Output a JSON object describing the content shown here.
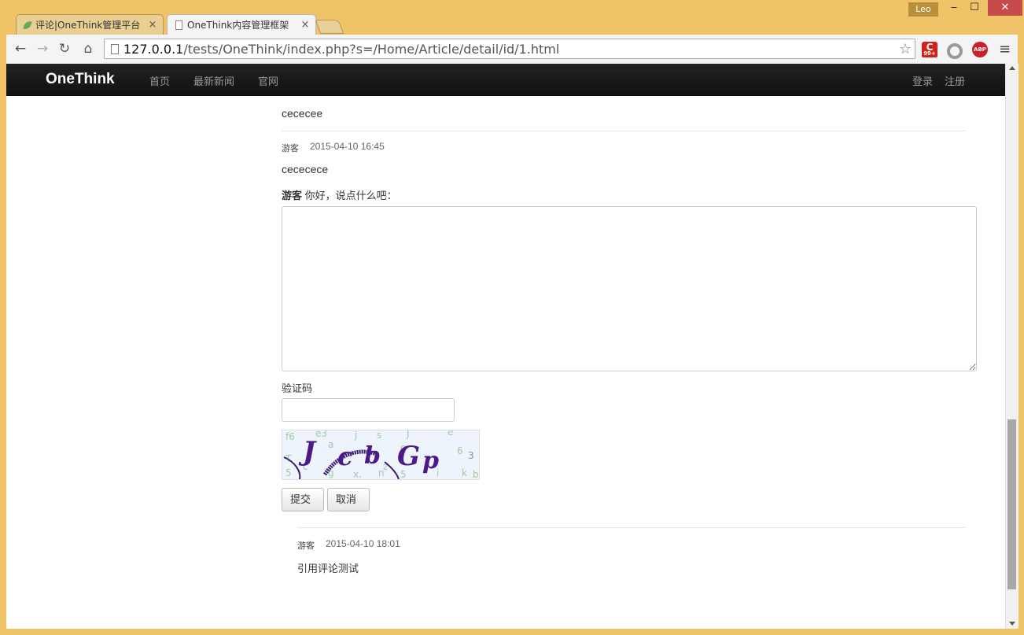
{
  "window": {
    "user": "Leo",
    "tabs": [
      {
        "title": "评论|OneThink管理平台",
        "active": false
      },
      {
        "title": "OneThink内容管理框架",
        "active": true
      }
    ],
    "url_host": "127.0.0.1",
    "url_path": "/tests/OneThink/index.php?s=/Home/Article/detail/id/1.html",
    "extension_badge": "99+",
    "abp_label": "ABP",
    "controls": {
      "minimize": "‒",
      "maximize": "☐",
      "close": "✕"
    }
  },
  "navbar": {
    "brand": "OneThink",
    "links": [
      "首页",
      "最新新闻",
      "官网"
    ],
    "login": "登录",
    "register": "注册"
  },
  "comments": {
    "first_text": "cececee",
    "second": {
      "author": "游客",
      "time": "2015-04-10 16:45",
      "text": "cececece"
    },
    "reply_form": {
      "user": "游客",
      "prompt": "你好，说点什么吧：",
      "captcha_label": "验证码",
      "captcha_text": "JcbGp",
      "submit": "提交",
      "cancel": "取消"
    },
    "third": {
      "author": "游客",
      "time": "2015-04-10 18:01",
      "text": "引用评论测试"
    }
  },
  "colors": {
    "window_frame": "#f0c368",
    "navbar_bg": "#1a1a1a",
    "close_button": "#c74b4a"
  }
}
